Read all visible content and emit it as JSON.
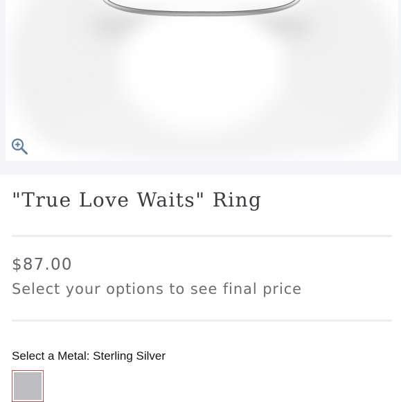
{
  "product": {
    "title": "\"True Love Waits\" Ring",
    "price": "$87.00",
    "price_note": "Select your options to see final price"
  },
  "options": {
    "metal_label": "Select a Metal:",
    "metal_selected": "Sterling Silver",
    "metal_label_full": "Select a Metal: Sterling Silver",
    "swatches": [
      {
        "name": "Sterling Silver",
        "color": "#bdbdbf",
        "selected": true
      }
    ]
  },
  "colors": {
    "swatch_border_selected": "#c9494e",
    "image_panel_bg": "#f4f5f8",
    "zoom_icon": "#5a7fa6"
  },
  "icons": {
    "zoom": "zoom-in-icon"
  }
}
